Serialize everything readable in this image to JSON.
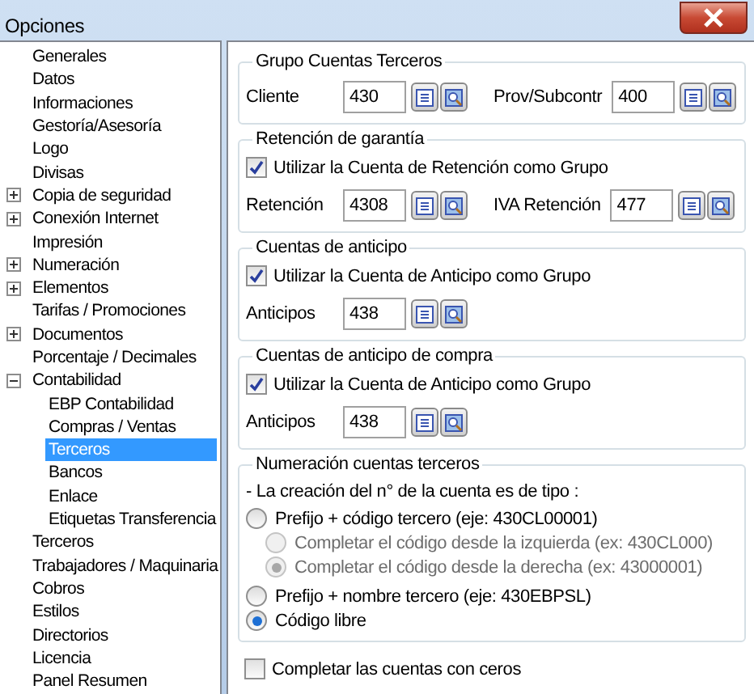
{
  "window": {
    "title": "Opciones"
  },
  "tree": [
    {
      "label": "Generales",
      "selected": false
    },
    {
      "label": "Datos",
      "selected": false
    },
    {
      "label": "Informaciones",
      "selected": false
    },
    {
      "label": "Gestoría/Asesoría",
      "selected": false
    },
    {
      "label": "Logo",
      "selected": false
    },
    {
      "label": "Divisas",
      "selected": false
    },
    {
      "label": "Copia de seguridad",
      "selected": false,
      "expanded": false
    },
    {
      "label": "Conexión Internet",
      "selected": false,
      "expanded": false
    },
    {
      "label": "Impresión",
      "selected": false
    },
    {
      "label": "Numeración",
      "selected": false,
      "expanded": false
    },
    {
      "label": "Elementos",
      "selected": false,
      "expanded": false
    },
    {
      "label": "Tarifas / Promociones",
      "selected": false
    },
    {
      "label": "Documentos",
      "selected": false,
      "expanded": false
    },
    {
      "label": "Porcentaje / Decimales",
      "selected": false
    },
    {
      "label": "Contabilidad",
      "selected": false,
      "expanded": true,
      "children": [
        {
          "label": "EBP Contabilidad",
          "selected": false
        },
        {
          "label": "Compras / Ventas",
          "selected": false
        },
        {
          "label": "Terceros",
          "selected": true
        },
        {
          "label": "Bancos",
          "selected": false
        },
        {
          "label": "Enlace",
          "selected": false
        },
        {
          "label": "Etiquetas Transferencia",
          "selected": false
        }
      ]
    },
    {
      "label": "Terceros",
      "selected": false
    },
    {
      "label": "Trabajadores / Maquinaria",
      "selected": false
    },
    {
      "label": "Cobros",
      "selected": false
    },
    {
      "label": "Estilos",
      "selected": false
    },
    {
      "label": "Directorios",
      "selected": false
    },
    {
      "label": "Licencia",
      "selected": false
    },
    {
      "label": "Panel Resumen",
      "selected": false
    }
  ],
  "groups": [
    {
      "title": "Grupo Cuentas Terceros",
      "fields": [
        {
          "label": "Cliente",
          "value": "430"
        },
        {
          "label": "Prov/Subcontr",
          "value": "400"
        }
      ]
    },
    {
      "title": "Retención de garantía",
      "checkbox": {
        "label": "Utilizar la Cuenta de Retención como Grupo",
        "checked": true
      },
      "fields": [
        {
          "label": "Retención",
          "value": "4308"
        },
        {
          "label": "IVA Retención",
          "value": "477"
        }
      ]
    },
    {
      "title": "Cuentas de anticipo",
      "checkbox": {
        "label": "Utilizar la Cuenta de Anticipo como Grupo",
        "checked": true
      },
      "fields": [
        {
          "label": "Anticipos",
          "value": "438"
        }
      ]
    },
    {
      "title": "Cuentas de anticipo de compra",
      "checkbox": {
        "label": "Utilizar la Cuenta de Anticipo como Grupo",
        "checked": true
      },
      "fields": [
        {
          "label": "Anticipos",
          "value": "438"
        }
      ]
    },
    {
      "title": "Numeración cuentas terceros",
      "note": "- La creación del n° de la cuenta es de tipo :",
      "options": [
        {
          "label": "Prefijo + código tercero (eje: 430CL00001)",
          "selected": false,
          "disabled": false,
          "children": [
            {
              "label": "Completar el código desde la izquierda (ex: 430CL000)",
              "selected": false,
              "disabled": true
            },
            {
              "label": "Completar el código desde la derecha (ex: 43000001)",
              "selected": true,
              "disabled": true
            }
          ]
        },
        {
          "label": "Prefijo + nombre tercero (eje: 430EBPSL)",
          "selected": false,
          "disabled": false
        },
        {
          "label": "Código libre",
          "selected": true,
          "disabled": false
        }
      ]
    }
  ],
  "bottom_checkbox": {
    "label": "Completar las cuentas con ceros",
    "checked": false
  }
}
